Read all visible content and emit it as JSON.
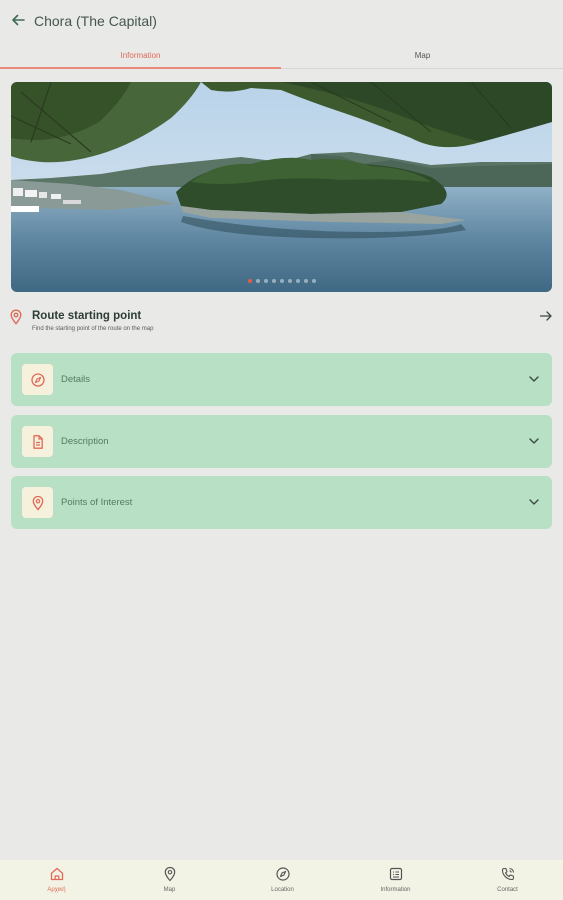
{
  "header": {
    "title": "Chora (The Capital)"
  },
  "tabs": [
    {
      "label": "Information",
      "active": true
    },
    {
      "label": "Map",
      "active": false
    }
  ],
  "carousel": {
    "slide_count": 9,
    "active_index": 0
  },
  "route": {
    "title": "Route starting point",
    "subtitle": "Find the starting point of the route on the map"
  },
  "sections": [
    {
      "label": "Details",
      "icon": "compass-icon"
    },
    {
      "label": "Description",
      "icon": "document-icon"
    },
    {
      "label": "Points of Interest",
      "icon": "location-pin-icon"
    }
  ],
  "bottom_nav": [
    {
      "label": "Αρχική",
      "icon": "home-icon",
      "active": true
    },
    {
      "label": "Map",
      "icon": "map-pin-icon",
      "active": false
    },
    {
      "label": "Location",
      "icon": "compass-icon",
      "active": false
    },
    {
      "label": "Information",
      "icon": "info-list-icon",
      "active": false
    },
    {
      "label": "Contact",
      "icon": "phone-icon",
      "active": false
    }
  ],
  "colors": {
    "background": "#e9e9e8",
    "accent": "#e06a57",
    "section_bg": "#b8e0c4",
    "icon_tile_bg": "#f6f1dd",
    "bottom_nav_bg": "#f2f3e4"
  }
}
